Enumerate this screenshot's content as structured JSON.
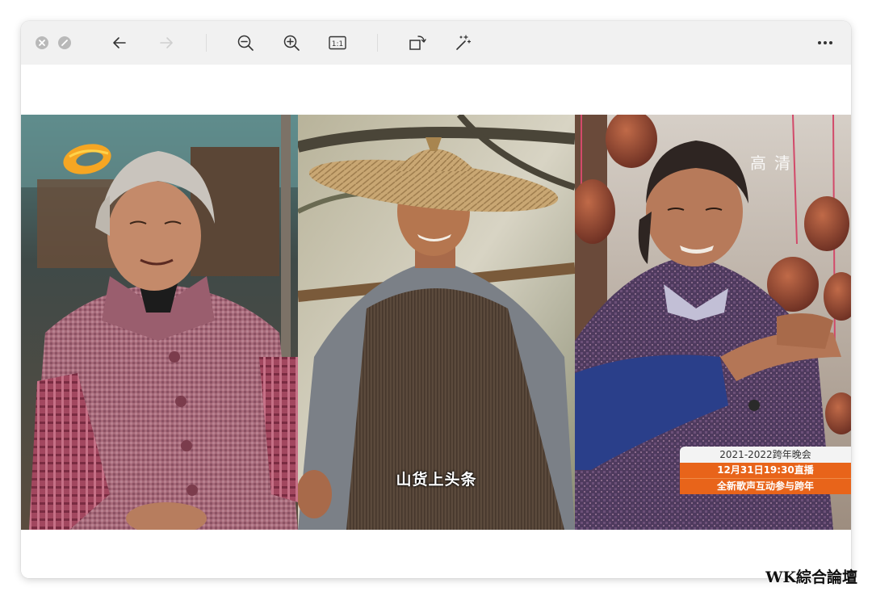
{
  "toolbar": {
    "close_icon": "close-icon",
    "minimize_icon": "minimize-icon",
    "back_icon": "arrow-left-icon",
    "forward_icon": "arrow-right-icon",
    "zoom_out_icon": "zoom-out-icon",
    "zoom_in_icon": "zoom-in-icon",
    "actual_size_label": "1:1",
    "rotate_icon": "rotate-icon",
    "enhance_icon": "magic-wand-icon",
    "more_icon": "more-icon"
  },
  "image": {
    "caption": "山货上头条",
    "hd_badge": "高清",
    "promo": {
      "line1": "2021-2022跨年晚会",
      "line2": "12月31日19:30直播",
      "line3": "全新歌声互动参与跨年"
    },
    "colors": {
      "promo_orange": "#e8641a",
      "logo_orange": "#f5a623"
    }
  },
  "watermark": "WK綜合論壇"
}
